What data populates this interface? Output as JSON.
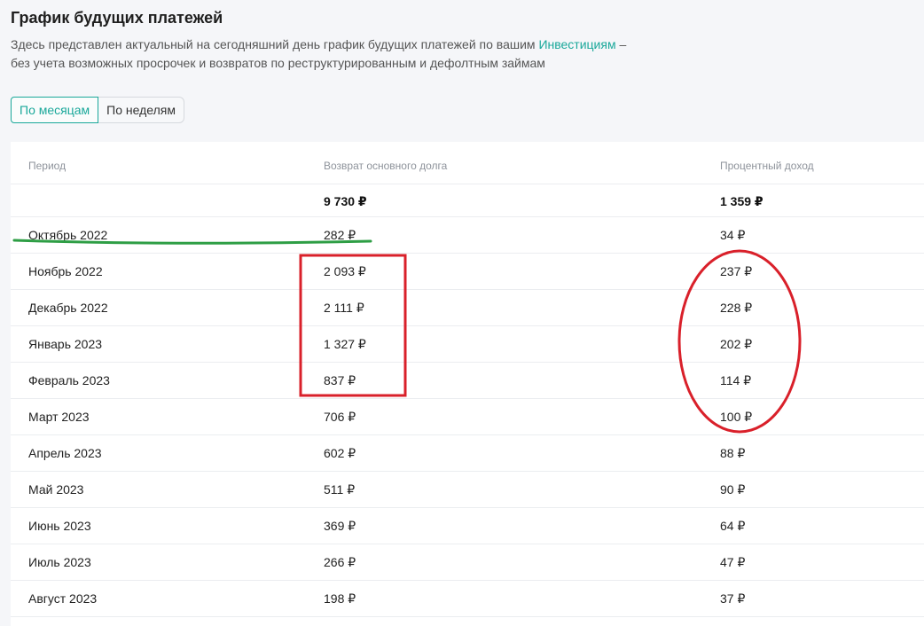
{
  "page": {
    "title": "График будущих платежей",
    "description_line1_before": "Здесь представлен актуальный на сегодняшний день график будущих платежей по вашим ",
    "description_link": "Инвестициям",
    "description_line1_after": " –",
    "description_line2": "без учета возможных просрочек и возвратов по реструктурированным и дефолтным займам"
  },
  "toggle": {
    "months_label": "По месяцам",
    "weeks_label": "По неделям",
    "selected": "По месяцам"
  },
  "table": {
    "headers": {
      "period": "Период",
      "principal": "Возврат основного долга",
      "interest": "Процентный доход"
    },
    "totals": {
      "period": "",
      "principal": "9 730 ₽",
      "interest": "1 359 ₽"
    },
    "rows": [
      {
        "period": "Октябрь 2022",
        "principal": "282 ₽",
        "interest": "34 ₽"
      },
      {
        "period": "Ноябрь 2022",
        "principal": "2 093 ₽",
        "interest": "237 ₽"
      },
      {
        "period": "Декабрь 2022",
        "principal": "2 111 ₽",
        "interest": "228 ₽"
      },
      {
        "period": "Январь 2023",
        "principal": "1 327 ₽",
        "interest": "202 ₽"
      },
      {
        "period": "Февраль 2023",
        "principal": "837 ₽",
        "interest": "114 ₽"
      },
      {
        "period": "Март 2023",
        "principal": "706 ₽",
        "interest": "100 ₽"
      },
      {
        "period": "Апрель 2023",
        "principal": "602 ₽",
        "interest": "88 ₽"
      },
      {
        "period": "Май 2023",
        "principal": "511 ₽",
        "interest": "90 ₽"
      },
      {
        "period": "Июнь 2023",
        "principal": "369 ₽",
        "interest": "64 ₽"
      },
      {
        "period": "Июль 2023",
        "principal": "266 ₽",
        "interest": "47 ₽"
      },
      {
        "period": "Август 2023",
        "principal": "198 ₽",
        "interest": "37 ₽"
      }
    ]
  },
  "annotations": {
    "underline_color": "#2e9e45",
    "highlight_color": "#d9202a"
  },
  "colors": {
    "accent": "#1aa89a",
    "background": "#f5f6f9",
    "card": "#ffffff"
  }
}
